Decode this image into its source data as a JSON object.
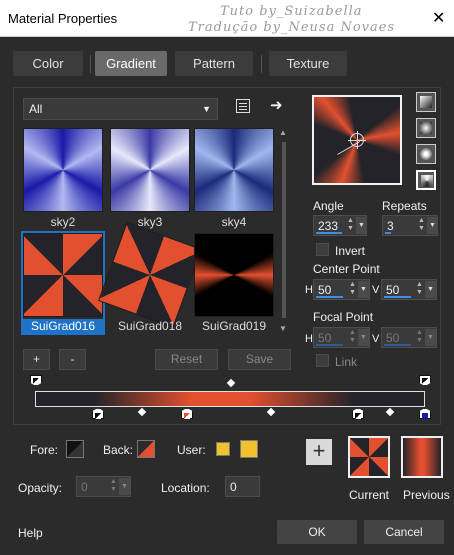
{
  "window": {
    "title": "Material Properties",
    "watermark_line1": "Tuto by_Suizabella",
    "watermark_line2": "Tradução by_Neusa Novaes",
    "close_glyph": "✕"
  },
  "tabs": [
    {
      "label": "Color",
      "active": false
    },
    {
      "label": "Gradient",
      "active": true
    },
    {
      "label": "Pattern",
      "active": false
    },
    {
      "label": "Texture",
      "active": false
    }
  ],
  "category": {
    "selected": "All",
    "caret": "▼"
  },
  "toolbar": {
    "listview_icon": "list-view-icon",
    "arrow_icon": "arrow-right-icon",
    "arrow_glyph": "➜"
  },
  "gradients": [
    {
      "name": "sky2",
      "kind": "sky",
      "a": "#1a1aa8",
      "b": "#b3b9f2",
      "selected": false
    },
    {
      "name": "sky3",
      "kind": "sky",
      "a": "#3a3aa6",
      "b": "#e6e8fb",
      "selected": false
    },
    {
      "name": "sky4",
      "kind": "sky",
      "a": "#1b2a7a",
      "b": "#9fb8ef",
      "selected": false
    },
    {
      "name": "SuiGrad016",
      "kind": "rb",
      "selected": true
    },
    {
      "name": "SuiGrad018",
      "kind": "rb",
      "selected": false
    },
    {
      "name": "SuiGrad019",
      "kind": "rb",
      "selected": false
    }
  ],
  "list_buttons": {
    "add": "+",
    "remove": "-",
    "reset": "Reset",
    "save": "Save"
  },
  "style_buttons": [
    "linear-style-icon",
    "rectangular-style-icon",
    "sunburst-style-icon",
    "radial-style-icon"
  ],
  "settings": {
    "angle_label": "Angle",
    "angle_value": "233",
    "repeats_label": "Repeats",
    "repeats_value": "3",
    "invert_label": "Invert",
    "invert_checked": false,
    "center_point_label": "Center Point",
    "center_h": "50",
    "center_v": "50",
    "focal_point_label": "Focal Point",
    "focal_h": "50",
    "focal_v": "50",
    "link_label": "Link",
    "link_checked": false,
    "h_label": "H",
    "v_label": "V"
  },
  "ramp": {
    "start_color": "#232329",
    "mid_color": "#e2502f",
    "end_color": "#232329"
  },
  "bottom": {
    "fore_label": "Fore:",
    "back_label": "Back:",
    "user_label": "User:",
    "opacity_label": "Opacity:",
    "opacity_value": "0",
    "location_label": "Location:",
    "location_value": "0",
    "user_color": "#f2c12e",
    "current_label": "Current",
    "previous_label": "Previous",
    "add_glyph": "+"
  },
  "footer": {
    "help": "Help",
    "ok": "OK",
    "cancel": "Cancel"
  }
}
